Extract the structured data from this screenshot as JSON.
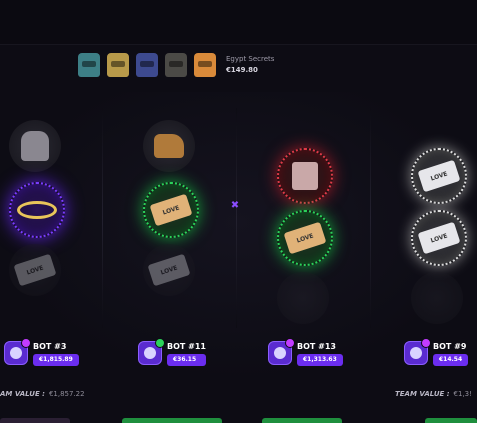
{
  "case": {
    "name": "Egypt Secrets",
    "price": "€149.80"
  },
  "case_icons": [
    {
      "name": "helmet-teal-icon",
      "color": "#3d7f86"
    },
    {
      "name": "helmet-gold-icon",
      "color": "#b89a4a"
    },
    {
      "name": "helmet-navy-icon",
      "color": "#3d4a8f"
    },
    {
      "name": "helmet-dark-icon",
      "color": "#4b4a46"
    },
    {
      "name": "helmet-orange-icon",
      "color": "#d98a3a"
    }
  ],
  "players": [
    {
      "name": "BOT #3",
      "value": "€1,815.89"
    },
    {
      "name": "BOT #11",
      "value": "€36.15"
    },
    {
      "name": "BOT #13",
      "value": "€1,313.63"
    },
    {
      "name": "BOT #9",
      "value": "€14.54"
    }
  ],
  "teams": [
    {
      "label": "AM VALUE :",
      "value": "€1,857.22"
    },
    {
      "label": "TEAM VALUE :",
      "value": "€1,3!"
    }
  ],
  "card_label": "LOVE",
  "vs_symbol": "✖",
  "colors": {
    "accent_purple": "#6b2df0",
    "glow_green": "#2bd35a",
    "glow_red": "#e03b48"
  }
}
